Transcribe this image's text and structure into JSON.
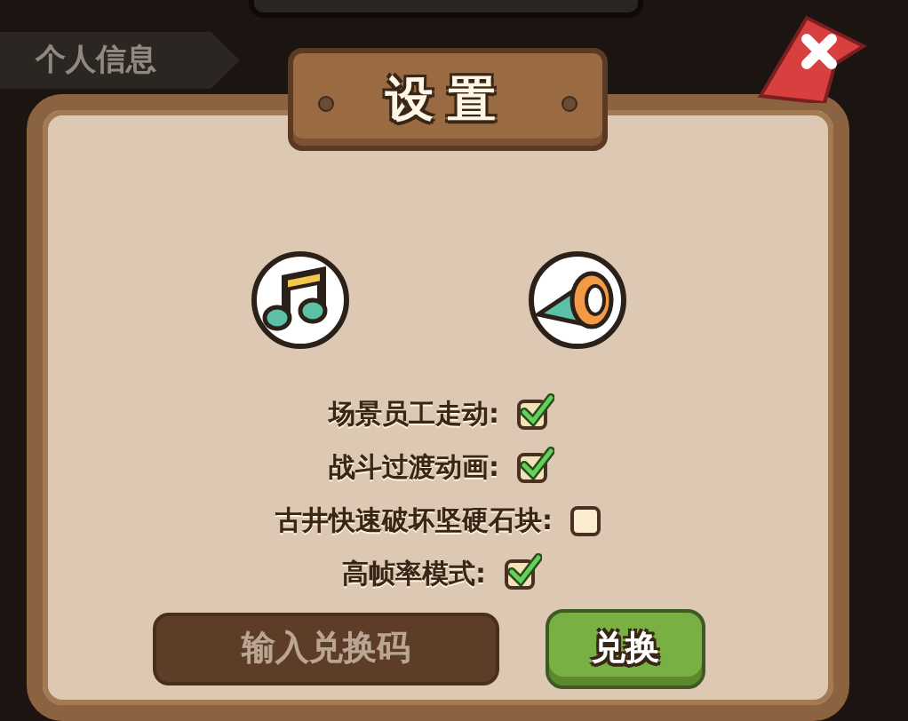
{
  "background_tab": {
    "label": "个人信息"
  },
  "dialog": {
    "title": "设置"
  },
  "options": [
    {
      "label": "场景员工走动:",
      "checked": true
    },
    {
      "label": "战斗过渡动画:",
      "checked": true
    },
    {
      "label": "古井快速破坏坚硬石块:",
      "checked": false
    },
    {
      "label": "高帧率模式:",
      "checked": true
    }
  ],
  "redeem": {
    "placeholder": "输入兑换码",
    "button": "兑换"
  }
}
